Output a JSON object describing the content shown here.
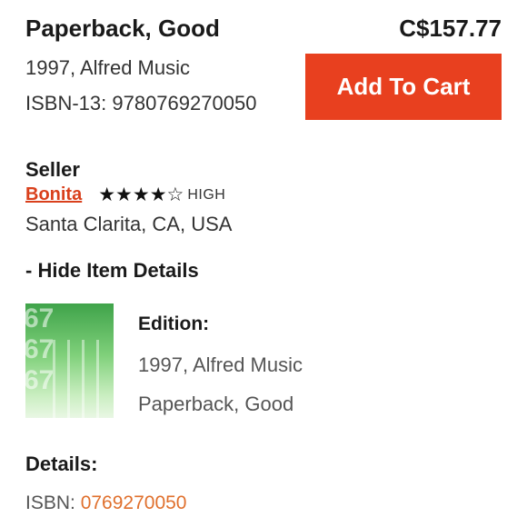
{
  "listing": {
    "title": "Paperback, Good",
    "price": "C$157.77",
    "publication": "1997, Alfred Music",
    "isbn13": "ISBN-13: 9780769270050",
    "add_to_cart_label": "Add To Cart",
    "accent_color": "#e8401f"
  },
  "seller": {
    "heading": "Seller",
    "name": "Bonita",
    "rating_stars": 4,
    "rating_max": 5,
    "rating_label": "HIGH",
    "location": "Santa Clarita, CA, USA"
  },
  "item_details": {
    "toggle_label": "- Hide Item Details",
    "thumbnail_icon": "book-cover-thumbnail",
    "edition_heading": "Edition:",
    "edition_publication": "1997, Alfred Music",
    "edition_format": "Paperback, Good",
    "details_heading": "Details:",
    "isbn_label": "ISBN: ",
    "isbn_value": "0769270050"
  }
}
